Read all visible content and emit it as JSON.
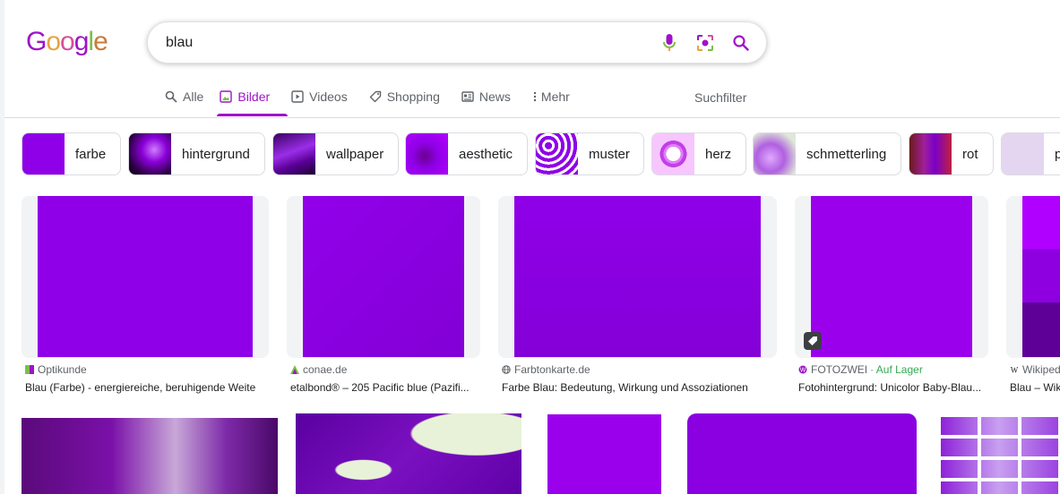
{
  "logo": {
    "letters": [
      "G",
      "o",
      "o",
      "g",
      "l",
      "e"
    ],
    "colors": [
      "#9e13c8",
      "#e8a33d",
      "#d64d9a",
      "#9e13c8",
      "#7bc043",
      "#c97a3a"
    ]
  },
  "search": {
    "query": "blau",
    "icons": [
      "mic-icon",
      "camera-lens-icon",
      "search-icon"
    ]
  },
  "tabs": [
    {
      "label": "Alle",
      "icon": "search-icon"
    },
    {
      "label": "Bilder",
      "icon": "image-icon",
      "active": true
    },
    {
      "label": "Videos",
      "icon": "video-icon"
    },
    {
      "label": "Shopping",
      "icon": "tag-icon"
    },
    {
      "label": "News",
      "icon": "news-icon"
    },
    {
      "label": "Mehr",
      "icon": "more-vert-icon"
    }
  ],
  "suchfilter": "Suchfilter",
  "chips": [
    {
      "label": "farbe"
    },
    {
      "label": "hintergrund"
    },
    {
      "label": "wallpaper"
    },
    {
      "label": "aesthetic"
    },
    {
      "label": "muster"
    },
    {
      "label": "herz"
    },
    {
      "label": "schmetterling"
    },
    {
      "label": "rot"
    },
    {
      "label": "p"
    }
  ],
  "results": [
    {
      "source": "Optikunde",
      "title": "Blau (Farbe) - energiereiche, beruhigende Weite"
    },
    {
      "source": "conae.de",
      "title": "etalbond® – 205 Pacific blue (Pazifi..."
    },
    {
      "source": "Farbtonkarte.de",
      "title": "Farbe Blau: Bedeutung, Wirkung und Assoziationen"
    },
    {
      "source": "FOTOZWEI",
      "stock": "· Auf Lager",
      "title": "Fotohintergrund: Unicolor Baby-Blau..."
    },
    {
      "source": "Wikipedia",
      "title": "Blau – Wikipedia"
    }
  ],
  "colors": {
    "accent": "#9e13c8",
    "purple": "#8f00e8",
    "purple_dark": "#7a00c9",
    "stock_green": "#34a853"
  }
}
